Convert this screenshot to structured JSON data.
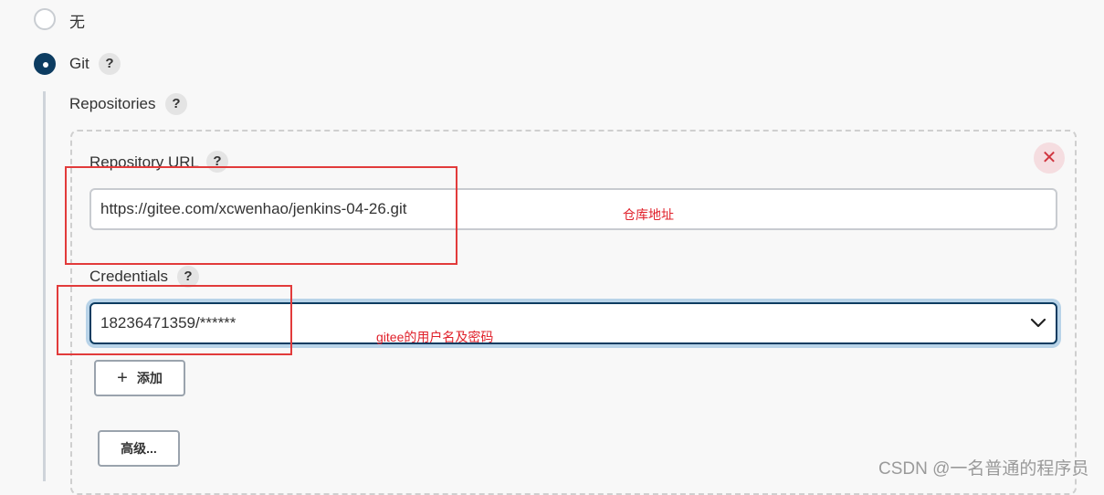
{
  "scm_options": [
    {
      "label": "无",
      "selected": false
    },
    {
      "label": "Git",
      "selected": true
    }
  ],
  "help_glyph": "?",
  "repositories_label": "Repositories",
  "repository": {
    "url_label": "Repository URL",
    "url_value": "https://gitee.com/xcwenhao/jenkins-04-26.git",
    "credentials_label": "Credentials",
    "credentials_value": "18236471359/******",
    "add_button": "添加",
    "advanced_button": "高级..."
  },
  "annotations": {
    "url_note": "仓库地址",
    "credentials_note": "gitee的用户名及密码"
  },
  "watermark": "CSDN @一名普通的程序员",
  "colors": {
    "accent": "#0d3c61",
    "annotation_red": "#e23b3b",
    "close_red": "#d0353f"
  },
  "icons": {
    "close": "close-icon",
    "dropdown": "chevron-down-icon",
    "add": "plus-icon"
  }
}
